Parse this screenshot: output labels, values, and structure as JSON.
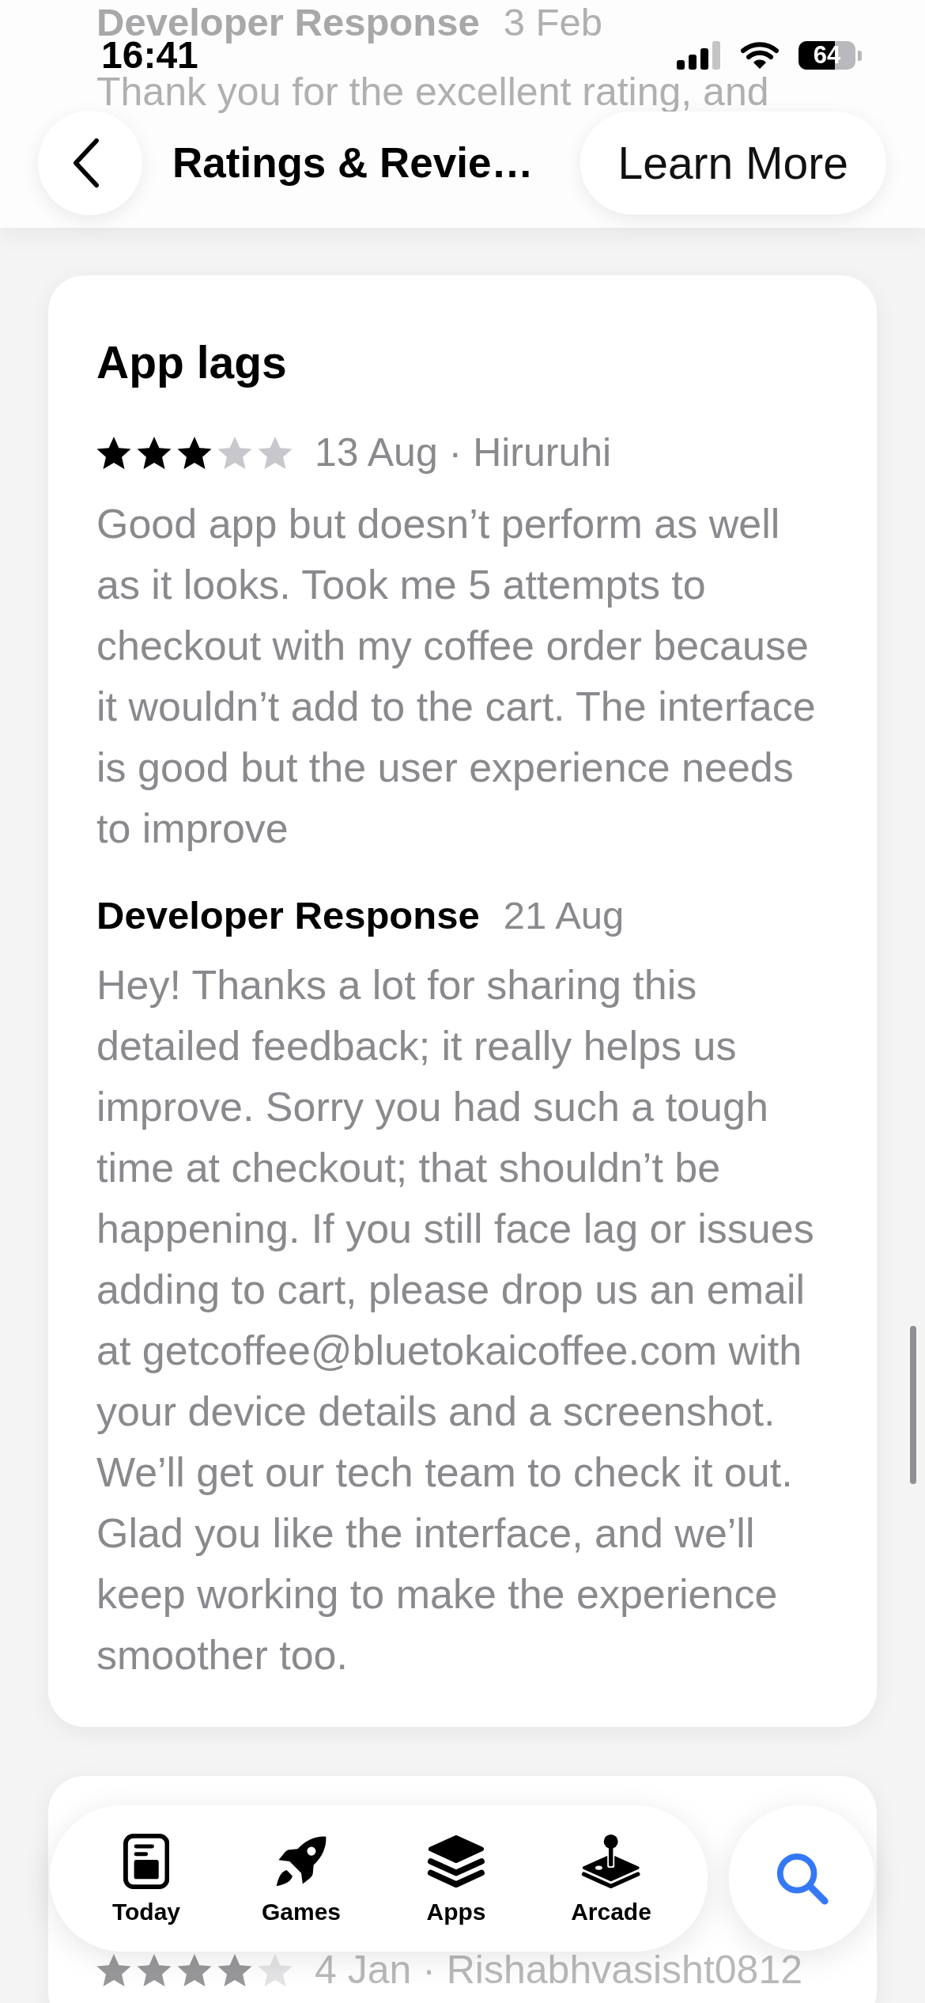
{
  "status_bar": {
    "time": "16:41",
    "battery": "64"
  },
  "previous_review": {
    "developer_response": {
      "label": "Developer Response",
      "date": "3 Feb",
      "text": "Thank you for the excellent rating, and"
    }
  },
  "nav_bar": {
    "title": "Ratings & Revie…",
    "action": "Learn More"
  },
  "reviews": [
    {
      "title": "App lags",
      "stars": 3,
      "meta": "13 Aug · Hiruruhi",
      "body": "Good app but doesn’t perform as well as it looks. Took me 5 attempts to checkout with my coffee order because it wouldn’t add to the cart. The interface is good but the user experience needs to improve",
      "developer_response": {
        "label": "Developer Response",
        "date": "21 Aug",
        "text": "Hey! Thanks a lot for sharing this detailed feedback; it really helps us improve. Sorry you had such a tough time at checkout; that shouldn’t be happening. If you still face lag or issues adding to cart, please drop us an email at getcoffee@bluetokaicoffee.com with your device details and a screenshot. We’ll get our tech team to check it out. Glad you like the interface, and we’ll keep working to make the experience smoother too."
      }
    },
    {
      "stars": 4,
      "meta": "4 Jan · Rishabhvasisht0812"
    }
  ],
  "tab_bar": {
    "tabs": [
      {
        "label": "Today",
        "selected": false
      },
      {
        "label": "Games",
        "selected": false
      },
      {
        "label": "Apps",
        "selected": false
      },
      {
        "label": "Arcade",
        "selected": false
      }
    ],
    "search": {
      "selected": true
    }
  }
}
